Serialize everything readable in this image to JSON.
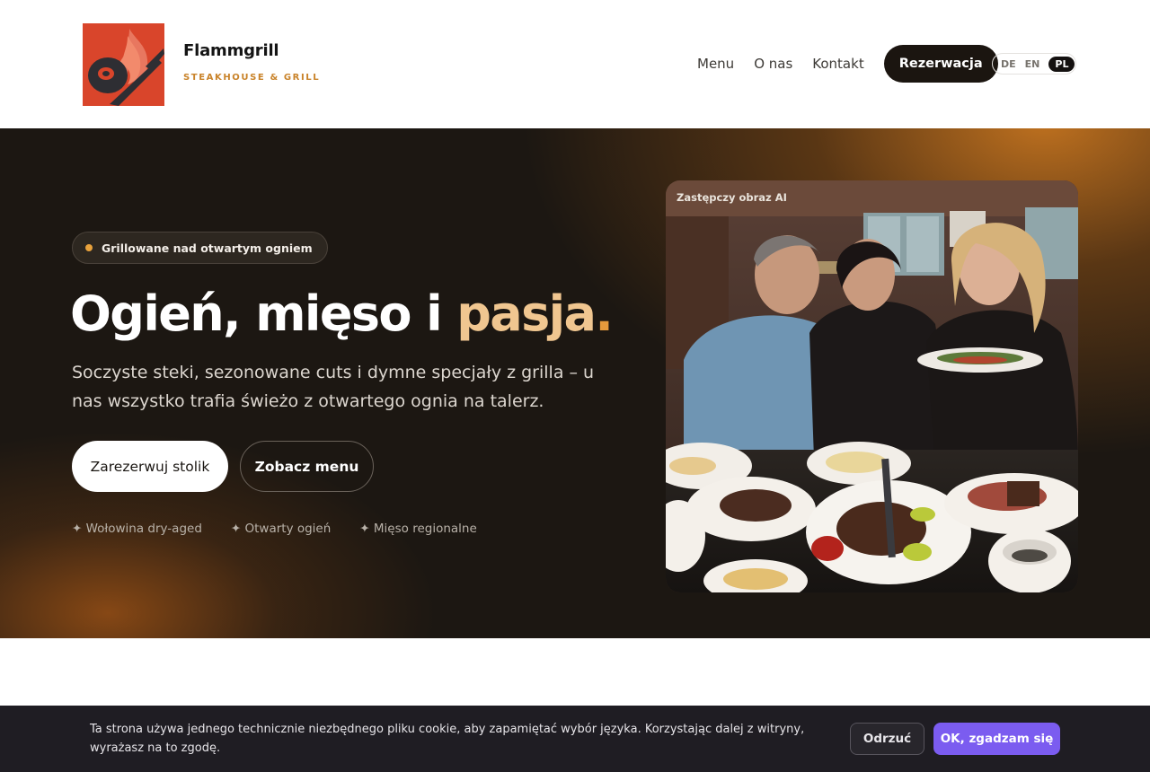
{
  "header": {
    "brand_name": "Flammgrill",
    "brand_tagline": "STEAKHOUSE & GRILL",
    "nav": {
      "menu": "Menu",
      "about": "O nas",
      "contact": "Kontakt",
      "reservation": "Rezerwacja"
    },
    "languages": [
      "DE",
      "EN",
      "PL"
    ],
    "active_language": "PL"
  },
  "hero": {
    "badge": "Grillowane nad otwartym ogniem",
    "title_main": "Ogień, mięso i ",
    "title_accent": "pasja",
    "title_dot": ".",
    "subtitle": "Soczyste steki, sezonowane cuts i dymne specjały z grilla – u nas wszystko trafia świeżo z otwartego ognia na talerz.",
    "primary_button": "Zarezerwuj stolik",
    "secondary_button": "Zobacz menu",
    "features": [
      "✦ Wołowina dry-aged",
      "✦ Otwarty ogień",
      "✦ Mięso regionalne"
    ],
    "image_label": "Zastępczy obraz AI"
  },
  "cookie": {
    "text": "Ta strona używa jednego technicznie niezbędnego pliku cookie, aby zapamiętać wybór języka. Korzystając dalej z witryny, wyrażasz na to zgodę.",
    "refuse": "Odrzuć",
    "accept": "OK, zgadzam się"
  },
  "colors": {
    "brand_orange": "#d9452b",
    "accent_gold": "#f0c690",
    "hero_bg": "#1c1712",
    "cookie_accept": "#7b5cf0"
  }
}
